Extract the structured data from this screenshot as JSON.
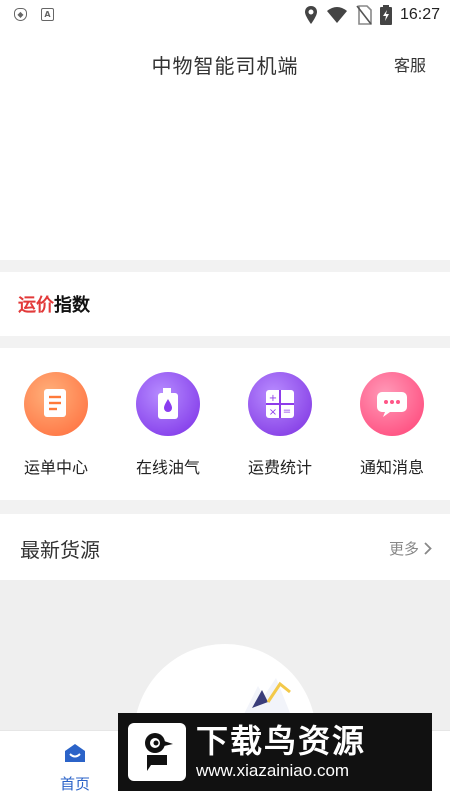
{
  "status_bar": {
    "left_icons": [
      "shield-icon",
      "a-badge-icon"
    ],
    "right_icons": [
      "location-icon",
      "wifi-icon",
      "no-sim-icon",
      "battery-charging-icon"
    ],
    "time": "16:27"
  },
  "header": {
    "title": "中物智能司机端",
    "service_label": "客服"
  },
  "index_banner": {
    "part1": "运价",
    "part2": "指数",
    "colors": {
      "part1": "#e23a3a",
      "part2": "#111111"
    }
  },
  "quick_menu": [
    {
      "label": "运单中心",
      "icon": "document-icon",
      "color": "#ff7a3a"
    },
    {
      "label": "在线油气",
      "icon": "fuel-can-icon",
      "color": "#8a3cf0"
    },
    {
      "label": "运费统计",
      "icon": "calculator-icon",
      "color": "#8e3cea"
    },
    {
      "label": "通知消息",
      "icon": "chat-bubble-icon",
      "color": "#ff5688"
    }
  ],
  "latest_cargo": {
    "title": "最新货源",
    "more_label": "更多"
  },
  "tabbar": {
    "home_label": "首页",
    "active_color": "#2b63c8"
  },
  "watermark": {
    "title": "下载鸟资源",
    "url": "www.xiazainiao.com"
  }
}
